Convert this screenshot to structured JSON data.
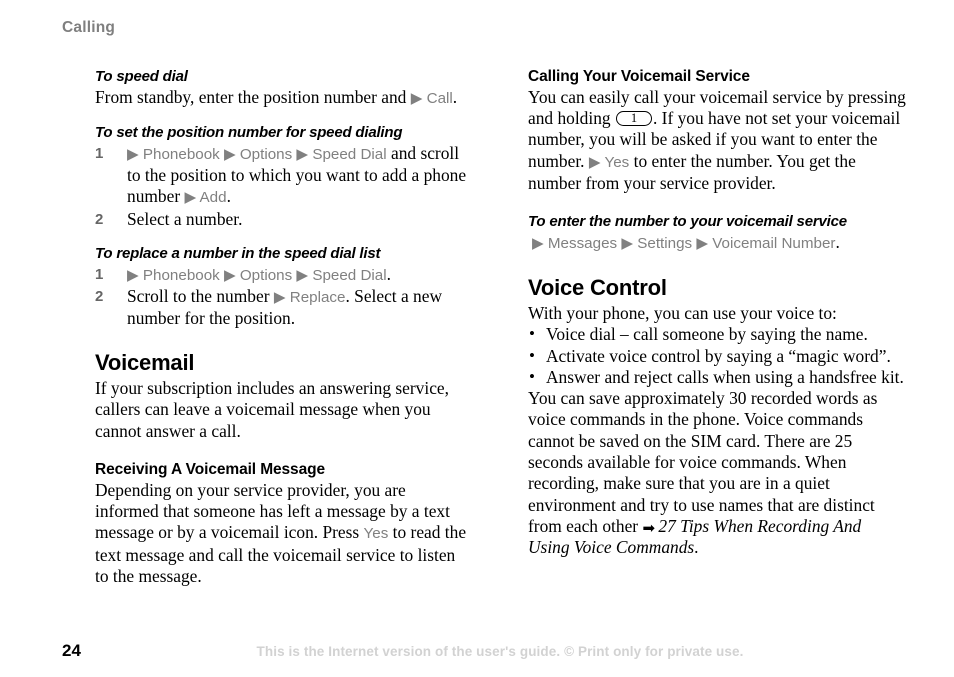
{
  "header": {
    "running_head": "Calling"
  },
  "colors": {
    "ui_reference": "#808080",
    "running_head": "#7f7f7f",
    "watermark": "#d2d2d2",
    "body_text": "#000000"
  },
  "icons": {
    "menu_arrow": "▶",
    "cross_reference_arrow": "➡",
    "bullet": "•"
  },
  "left_column": {
    "speed_dial_task": {
      "heading": "To speed dial",
      "line_pre": "From standby, enter the position number and ",
      "ui_call": "▶ Call",
      "line_post": "."
    },
    "set_position_task": {
      "heading": "To set the position number for speed dialing",
      "steps": [
        {
          "number": "1",
          "ui_path": "▶ Phonebook ▶ Options ▶ Speed Dial",
          "text_after": " and scroll to the position to which you want to add a phone number ",
          "ui_tail": "▶ Add",
          "tail_after": "."
        },
        {
          "number": "2",
          "ui_path": "",
          "text_after": "Select a number.",
          "ui_tail": "",
          "tail_after": ""
        }
      ]
    },
    "replace_number_task": {
      "heading": "To replace a number in the speed dial list",
      "steps": [
        {
          "number": "1",
          "ui_path": "▶ Phonebook ▶ Options ▶ Speed Dial",
          "text_after": "",
          "ui_tail": "",
          "tail_after": "."
        },
        {
          "number": "2",
          "ui_path": "",
          "text_after": "Scroll to the number ",
          "ui_tail": "▶ Replace",
          "tail_after": ". Select a new number for the position."
        }
      ]
    },
    "voicemail_section": {
      "heading": "Voicemail",
      "paragraph": "If your subscription includes an answering service, callers can leave a voicemail message when you cannot answer a call."
    },
    "receiving_subsection": {
      "heading": "Receiving A Voicemail Message",
      "part1": "Depending on your service provider, you are informed that someone has left a message by a text message or by a voicemail icon. Press ",
      "ui_yes": "Yes",
      "part2": " to read the text message and call the voicemail service to listen to the message."
    }
  },
  "right_column": {
    "calling_voicemail_subsection": {
      "heading": "Calling Your Voicemail Service",
      "part1": "You can easily call your voicemail service by pressing and holding ",
      "key_label": "1",
      "part2": ". If you have not set your voicemail number, you will be asked if you want to enter the number. ",
      "ui_yes": "▶ Yes",
      "part3": " to enter the number. You get the number from your service provider."
    },
    "enter_number_task": {
      "heading": "To enter the number to your voicemail service",
      "ui_path": "▶ Messages ▶ Settings ▶ Voicemail Number",
      "trailing": "."
    },
    "voice_control_section": {
      "heading": "Voice Control",
      "intro": "With your phone, you can use your voice to:",
      "bullets": [
        "Voice dial – call someone by saying the name.",
        "Activate voice control by saying a “magic word”.",
        "Answer and reject calls when using a handsfree kit."
      ],
      "paragraph_part1": "You can save approximately 30 recorded words as voice commands in the phone. Voice commands cannot be saved on the SIM card. There are 25 seconds available for voice commands. When recording, make sure that you are in a quiet environment and try to use names that are distinct from each other ",
      "cross_reference": "27 Tips When Recording And Using Voice Commands",
      "paragraph_part2": "."
    }
  },
  "footer": {
    "page_number": "24",
    "watermark": "This is the Internet version of the user's guide. © Print only for private use."
  }
}
